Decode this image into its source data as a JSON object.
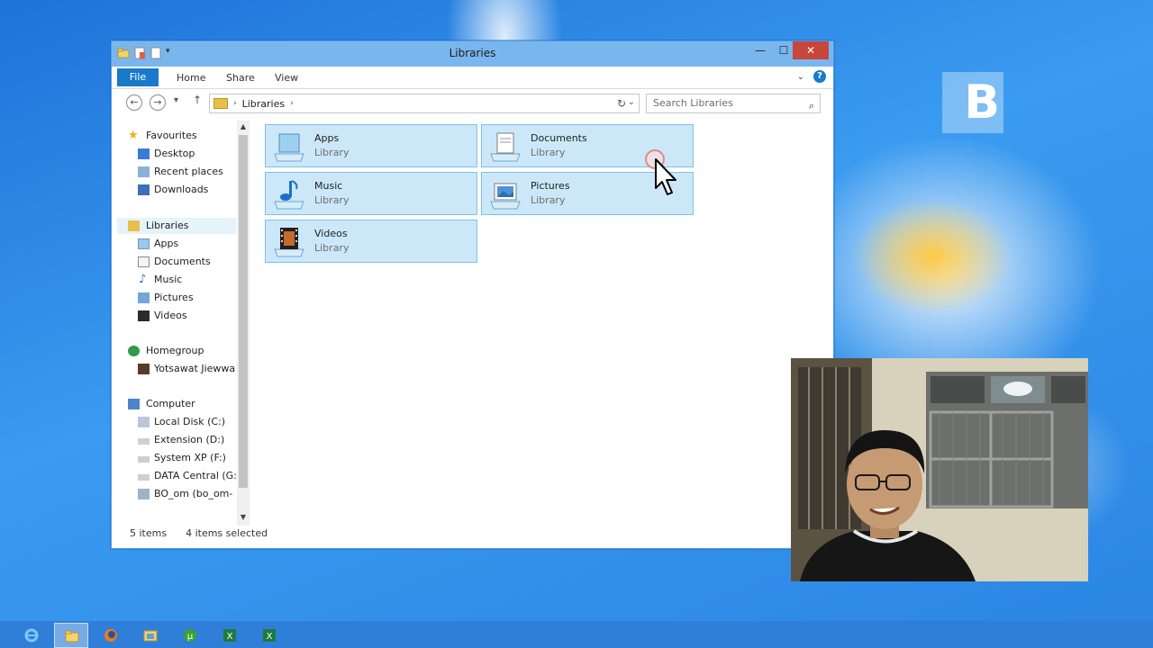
{
  "window": {
    "title": "Libraries",
    "controls": {
      "minimize": "—",
      "maximize": "☐",
      "close": "✕"
    }
  },
  "ribbon": {
    "tabs": [
      "File",
      "Home",
      "Share",
      "View"
    ]
  },
  "address": {
    "crumb": "Libraries",
    "search_placeholder": "Search Libraries"
  },
  "nav": {
    "favourites": "Favourites",
    "desktop": "Desktop",
    "recent_places": "Recent places",
    "downloads": "Downloads",
    "libraries": "Libraries",
    "apps": "Apps",
    "documents": "Documents",
    "music": "Music",
    "pictures": "Pictures",
    "videos": "Videos",
    "homegroup": "Homegroup",
    "homegroup_user": "Yotsawat Jiewwa",
    "computer": "Computer",
    "local_disk": "Local Disk (C:)",
    "extension": "Extension (D:)",
    "system_xp": "System XP (F:)",
    "data_central": "DATA Central (G:",
    "network_share": "BO_om (bo_om-"
  },
  "content": {
    "libraries": [
      {
        "name": "Apps",
        "type": "Library"
      },
      {
        "name": "Documents",
        "type": "Library"
      },
      {
        "name": "Music",
        "type": "Library"
      },
      {
        "name": "Pictures",
        "type": "Library"
      },
      {
        "name": "Videos",
        "type": "Library"
      }
    ]
  },
  "status": {
    "items": "5 items",
    "selected": "4 items selected"
  },
  "taskbar": {
    "apps": [
      "internet-explorer",
      "file-explorer",
      "firefox",
      "photo-viewer",
      "utorrent",
      "excel",
      "excel-2"
    ]
  },
  "colors": {
    "titlebar": "#7ab6ee",
    "selection": "#cce8f8",
    "file_tab": "#1979ca",
    "close_button": "#c7463a"
  }
}
